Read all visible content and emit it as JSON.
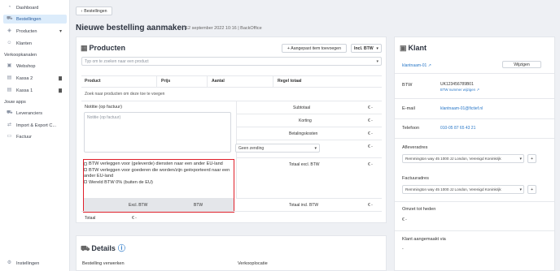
{
  "sidebar": {
    "items": [
      {
        "label": "Dashboard",
        "icon": "gauge-icon"
      },
      {
        "label": "Bestellingen",
        "icon": "cart-icon"
      },
      {
        "label": "Producten",
        "icon": "tag-icon"
      },
      {
        "label": "Klanten",
        "icon": "users-icon"
      }
    ],
    "section_sales": "Verkoopkanalen",
    "sales_items": [
      {
        "label": "Webshop",
        "icon": "store-icon"
      },
      {
        "label": "Kassa 2",
        "icon": "register-icon"
      },
      {
        "label": "Kassa 1",
        "icon": "register-icon"
      }
    ],
    "section_apps": "Jouw apps",
    "app_items": [
      {
        "label": "Leveranciers",
        "icon": "truck-icon"
      },
      {
        "label": "Import & Export C...",
        "icon": "swap-icon"
      },
      {
        "label": "Factuur",
        "icon": "invoice-icon"
      }
    ],
    "settings": "Instellingen"
  },
  "header": {
    "back": "Bestellingen",
    "title": "Nieuwe bestelling aanmaken",
    "meta": "12 september 2022 10:16 | BackOffice"
  },
  "products": {
    "title": "Producten",
    "add_custom": "+ Aangepast item toevoegen",
    "vat_mode": "Incl. BTW",
    "search_placeholder": "Typ om te zoeken naar een product",
    "columns": [
      "Product",
      "Prijs",
      "Aantal",
      "Regel totaal"
    ],
    "empty": "Zoek naar producten om deze toe te voegen",
    "note_label": "Notitie (op factuur)",
    "note_placeholder": "Notitie (op factuur)",
    "subtotal_label": "Subtotaal",
    "subtotal_value": "€ -",
    "discount_label": "Korting",
    "discount_value": "€ -",
    "payment_label": "Betalingskosten",
    "payment_value": "€ -",
    "shipping_select": "Geen zending",
    "shipping_value": "€ -",
    "total_excl_label": "Totaal excl. BTW",
    "total_excl_value": "€ -",
    "vat_options": [
      "BTW verleggen voor (geleverde) diensten naar een ander EU-land",
      "BTW verleggen voor goederen die worden/zijn geëxporteerd naar een ander EU-land",
      "Wereld BTW 0% (buiten de EU)"
    ],
    "vat_col_excl": "Excl. BTW",
    "vat_col_btw": "BTW",
    "total_incl_label": "Totaal incl. BTW",
    "total_incl_value": "€ -",
    "total_label": "Totaal",
    "total_value": "€ -"
  },
  "details": {
    "title": "Details",
    "handle_label": "Bestelling verwerken",
    "location_label": "Verkooplocatie"
  },
  "customer": {
    "title": "Klant",
    "name": "klantnaam-01",
    "change": "Wijzigen",
    "vat_label": "BTW",
    "vat_value": "UK123456789B01",
    "vat_change": "BTW nummer wijzigen",
    "email_label": "E-mail",
    "email_value": "klantnaam-01@fictief.nl",
    "phone_label": "Telefoon",
    "phone_value": "010-05 87 65 43 21",
    "delivery_label": "Afleveradres",
    "delivery_value": "Remmington way 45 1000 JJ London, Verenigd Koninkrijk",
    "invoice_label": "Factuuradres",
    "invoice_value": "Remmington way 45 1000 JJ London, Verenigd Koninkrijk",
    "revenue_label": "Omzet tot heden",
    "revenue_value": "€ -",
    "created_label": "Klant aangemaakt via",
    "created_value": "-"
  }
}
